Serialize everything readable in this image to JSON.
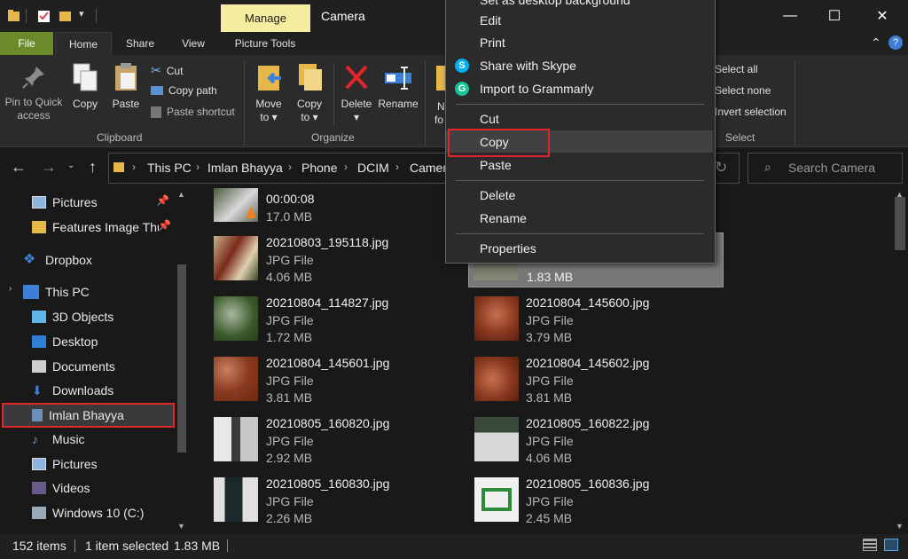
{
  "titlebar": {
    "title": "Camera",
    "manage_tab": "Manage",
    "minimize_glyph": "—",
    "maximize_glyph": "☐",
    "close_glyph": "✕"
  },
  "ribbon_tabs": {
    "file": "File",
    "home": "Home",
    "share": "Share",
    "view": "View",
    "picture_tools": "Picture Tools"
  },
  "ribbon": {
    "pin_line1": "Pin to Quick",
    "pin_line2": "access",
    "copy": "Copy",
    "paste": "Paste",
    "cut": "Cut",
    "copy_path": "Copy path",
    "paste_shortcut": "Paste shortcut",
    "clipboard_group": "Clipboard",
    "move_to_line1": "Move",
    "move_to_line2": "to",
    "copy_to_line1": "Copy",
    "copy_to_line2": "to",
    "delete": "Delete",
    "rename": "Rename",
    "organize_group": "Organize",
    "new_folder_line1": "N",
    "new_folder_line2": "fo",
    "select_all": "Select all",
    "select_none": "Select none",
    "invert_selection": "Invert selection",
    "select_group": "Select"
  },
  "address": {
    "crumbs": [
      "This PC",
      "Imlan Bhayya",
      "Phone",
      "DCIM",
      "Camer"
    ],
    "search_placeholder": "Search Camera"
  },
  "nav": {
    "items": [
      {
        "label": "Pictures",
        "icon": "pictures-icon"
      },
      {
        "label": "Features Image Thu",
        "icon": "folder-icon"
      },
      {
        "label": "Dropbox",
        "icon": "dropbox-icon"
      },
      {
        "label": "This PC",
        "icon": "computer-icon"
      },
      {
        "label": "3D Objects",
        "icon": "3d-objects-icon"
      },
      {
        "label": "Desktop",
        "icon": "desktop-icon"
      },
      {
        "label": "Documents",
        "icon": "documents-icon"
      },
      {
        "label": "Downloads",
        "icon": "downloads-icon"
      },
      {
        "label": "Imlan Bhayya",
        "icon": "phone-icon"
      },
      {
        "label": "Music",
        "icon": "music-icon"
      },
      {
        "label": "Pictures",
        "icon": "pictures-icon"
      },
      {
        "label": "Videos",
        "icon": "videos-icon"
      },
      {
        "label": "Windows 10 (C:)",
        "icon": "drive-icon"
      }
    ]
  },
  "files": {
    "top_video": {
      "duration": "00:00:08",
      "size": "17.0 MB"
    },
    "selected_size": "1.83 MB",
    "items": [
      {
        "name": "20210803_195118.jpg",
        "type": "JPG File",
        "size": "4.06 MB"
      },
      {
        "name": "20210804_114827.jpg",
        "type": "JPG File",
        "size": "1.72 MB"
      },
      {
        "name": "20210804_145600.jpg",
        "type": "JPG File",
        "size": "3.79 MB"
      },
      {
        "name": "20210804_145601.jpg",
        "type": "JPG File",
        "size": "3.81 MB"
      },
      {
        "name": "20210804_145602.jpg",
        "type": "JPG File",
        "size": "3.81 MB"
      },
      {
        "name": "20210805_160820.jpg",
        "type": "JPG File",
        "size": "2.92 MB"
      },
      {
        "name": "20210805_160822.jpg",
        "type": "JPG File",
        "size": "4.06 MB"
      },
      {
        "name": "20210805_160830.jpg",
        "type": "JPG File",
        "size": "2.26 MB"
      },
      {
        "name": "20210805_160836.jpg",
        "type": "JPG File",
        "size": "2.45 MB"
      }
    ]
  },
  "context_menu": {
    "set_background": "Set as desktop background",
    "edit": "Edit",
    "print": "Print",
    "share_skype": "Share with Skype",
    "grammarly": "Import to Grammarly",
    "cut": "Cut",
    "copy": "Copy",
    "paste": "Paste",
    "delete": "Delete",
    "rename": "Rename",
    "properties": "Properties"
  },
  "status": {
    "items_count": "152 items",
    "selection": "1 item selected",
    "size": "1.83 MB"
  },
  "colors": {
    "accent_red": "#e0262b",
    "file_tab": "#6b8a2a",
    "manage_tab": "#f5eea0"
  }
}
